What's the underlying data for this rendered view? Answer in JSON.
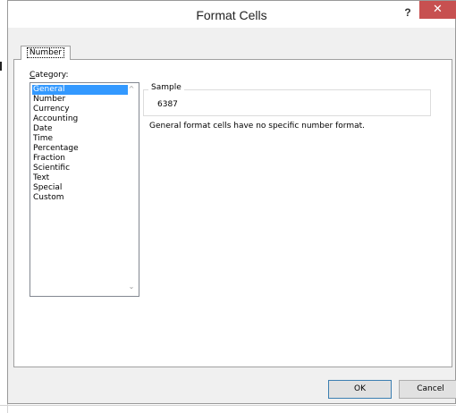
{
  "window": {
    "title": "Format Cells",
    "help_label": "?",
    "close_label": "✕"
  },
  "tabs": [
    {
      "label": "Number",
      "active": true
    }
  ],
  "category": {
    "label_accel": "C",
    "label_rest": "ategory:",
    "items": [
      "General",
      "Number",
      "Currency",
      "Accounting",
      "Date",
      "Time",
      "Percentage",
      "Fraction",
      "Scientific",
      "Text",
      "Special",
      "Custom"
    ],
    "selected": "General",
    "scroll_up_glyph": "^",
    "scroll_down_glyph": "⌄"
  },
  "sample": {
    "caption": "Sample",
    "value": "6387"
  },
  "description": "General format cells have no specific number format.",
  "buttons": {
    "ok": "OK",
    "cancel": "Cancel"
  },
  "colors": {
    "selection": "#3399ff",
    "close_button": "#c75050",
    "dialog_face": "#f0f0f0"
  }
}
